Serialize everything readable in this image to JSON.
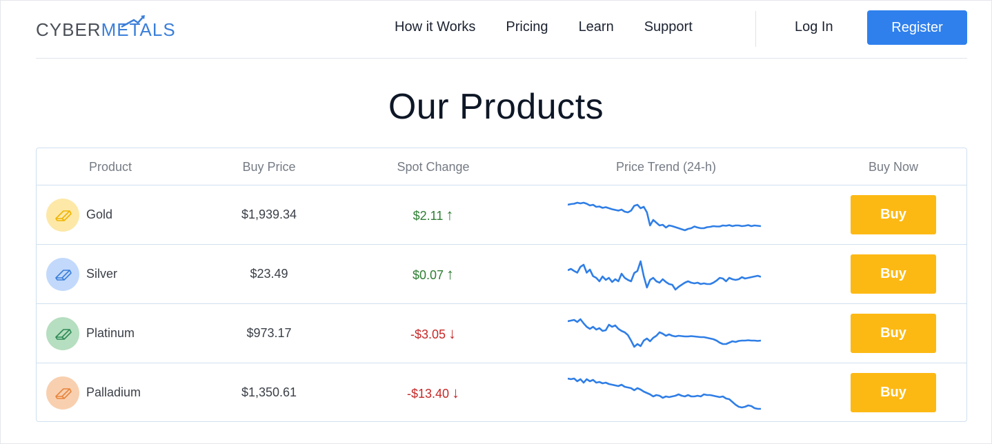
{
  "brand": {
    "part1": "CYBER",
    "part2": "METALS",
    "color_primary": "#3b7fd9",
    "color_text": "#4a4f57"
  },
  "nav": {
    "items": [
      "How it Works",
      "Pricing",
      "Learn",
      "Support"
    ]
  },
  "auth": {
    "login": "Log In",
    "register": "Register"
  },
  "page": {
    "title": "Our Products"
  },
  "table": {
    "headers": [
      "Product",
      "Buy Price",
      "Spot Change",
      "Price Trend (24-h)",
      "Buy Now"
    ],
    "rows": [
      {
        "name": "Gold",
        "price": "$1,939.34",
        "change": "$2.11",
        "direction": "up",
        "arrow": "↑",
        "buy": "Buy",
        "icon": "gold-bar-icon",
        "icon_bg": "#fde8a8",
        "icon_color": "#f0b400",
        "trend": [
          0.8,
          0.82,
          0.83,
          0.86,
          0.84,
          0.86,
          0.83,
          0.78,
          0.8,
          0.74,
          0.75,
          0.71,
          0.73,
          0.7,
          0.67,
          0.65,
          0.63,
          0.66,
          0.6,
          0.58,
          0.63,
          0.77,
          0.8,
          0.7,
          0.74,
          0.58,
          0.2,
          0.36,
          0.28,
          0.2,
          0.22,
          0.14,
          0.2,
          0.18,
          0.15,
          0.12,
          0.09,
          0.06,
          0.1,
          0.12,
          0.17,
          0.14,
          0.12,
          0.12,
          0.15,
          0.16,
          0.18,
          0.17,
          0.17,
          0.2,
          0.19,
          0.21,
          0.18,
          0.2,
          0.2,
          0.18,
          0.19,
          0.21,
          0.18,
          0.2,
          0.19,
          0.18
        ]
      },
      {
        "name": "Silver",
        "price": "$23.49",
        "change": "$0.07",
        "direction": "up",
        "arrow": "↑",
        "buy": "Buy",
        "icon": "silver-bar-icon",
        "icon_bg": "#c2d9fb",
        "icon_color": "#3b7fd9",
        "trend": [
          0.62,
          0.66,
          0.6,
          0.55,
          0.72,
          0.78,
          0.55,
          0.64,
          0.45,
          0.4,
          0.3,
          0.44,
          0.34,
          0.4,
          0.28,
          0.36,
          0.3,
          0.52,
          0.4,
          0.34,
          0.3,
          0.54,
          0.6,
          0.88,
          0.45,
          0.12,
          0.34,
          0.4,
          0.3,
          0.26,
          0.36,
          0.28,
          0.22,
          0.2,
          0.06,
          0.14,
          0.2,
          0.26,
          0.3,
          0.26,
          0.24,
          0.26,
          0.22,
          0.24,
          0.22,
          0.22,
          0.26,
          0.32,
          0.4,
          0.38,
          0.3,
          0.4,
          0.36,
          0.34,
          0.36,
          0.42,
          0.38,
          0.4,
          0.42,
          0.44,
          0.46,
          0.43
        ]
      },
      {
        "name": "Platinum",
        "price": "$973.17",
        "change": "-$3.05",
        "direction": "down",
        "arrow": "↓",
        "buy": "Buy",
        "icon": "platinum-bar-icon",
        "icon_bg": "#b6dec0",
        "icon_color": "#2e8b57",
        "trend": [
          0.86,
          0.88,
          0.9,
          0.84,
          0.92,
          0.8,
          0.7,
          0.64,
          0.7,
          0.62,
          0.66,
          0.58,
          0.6,
          0.76,
          0.7,
          0.74,
          0.64,
          0.58,
          0.54,
          0.46,
          0.3,
          0.12,
          0.2,
          0.14,
          0.3,
          0.36,
          0.28,
          0.38,
          0.44,
          0.54,
          0.5,
          0.44,
          0.48,
          0.44,
          0.42,
          0.44,
          0.43,
          0.42,
          0.42,
          0.43,
          0.42,
          0.41,
          0.4,
          0.4,
          0.38,
          0.36,
          0.34,
          0.3,
          0.24,
          0.2,
          0.2,
          0.24,
          0.28,
          0.26,
          0.29,
          0.3,
          0.3,
          0.31,
          0.3,
          0.3,
          0.29,
          0.3
        ]
      },
      {
        "name": "Palladium",
        "price": "$1,350.61",
        "change": "-$13.40",
        "direction": "down",
        "arrow": "↓",
        "buy": "Buy",
        "icon": "palladium-bar-icon",
        "icon_bg": "#f8d0b0",
        "icon_color": "#e8843c",
        "trend": [
          0.92,
          0.9,
          0.92,
          0.84,
          0.9,
          0.8,
          0.9,
          0.84,
          0.88,
          0.8,
          0.82,
          0.78,
          0.8,
          0.76,
          0.74,
          0.72,
          0.7,
          0.74,
          0.68,
          0.66,
          0.64,
          0.58,
          0.64,
          0.6,
          0.54,
          0.5,
          0.46,
          0.4,
          0.44,
          0.42,
          0.36,
          0.4,
          0.38,
          0.4,
          0.42,
          0.46,
          0.42,
          0.4,
          0.44,
          0.4,
          0.4,
          0.42,
          0.4,
          0.46,
          0.44,
          0.44,
          0.42,
          0.4,
          0.38,
          0.4,
          0.34,
          0.32,
          0.24,
          0.16,
          0.1,
          0.08,
          0.1,
          0.14,
          0.12,
          0.06,
          0.04,
          0.04
        ]
      }
    ]
  }
}
